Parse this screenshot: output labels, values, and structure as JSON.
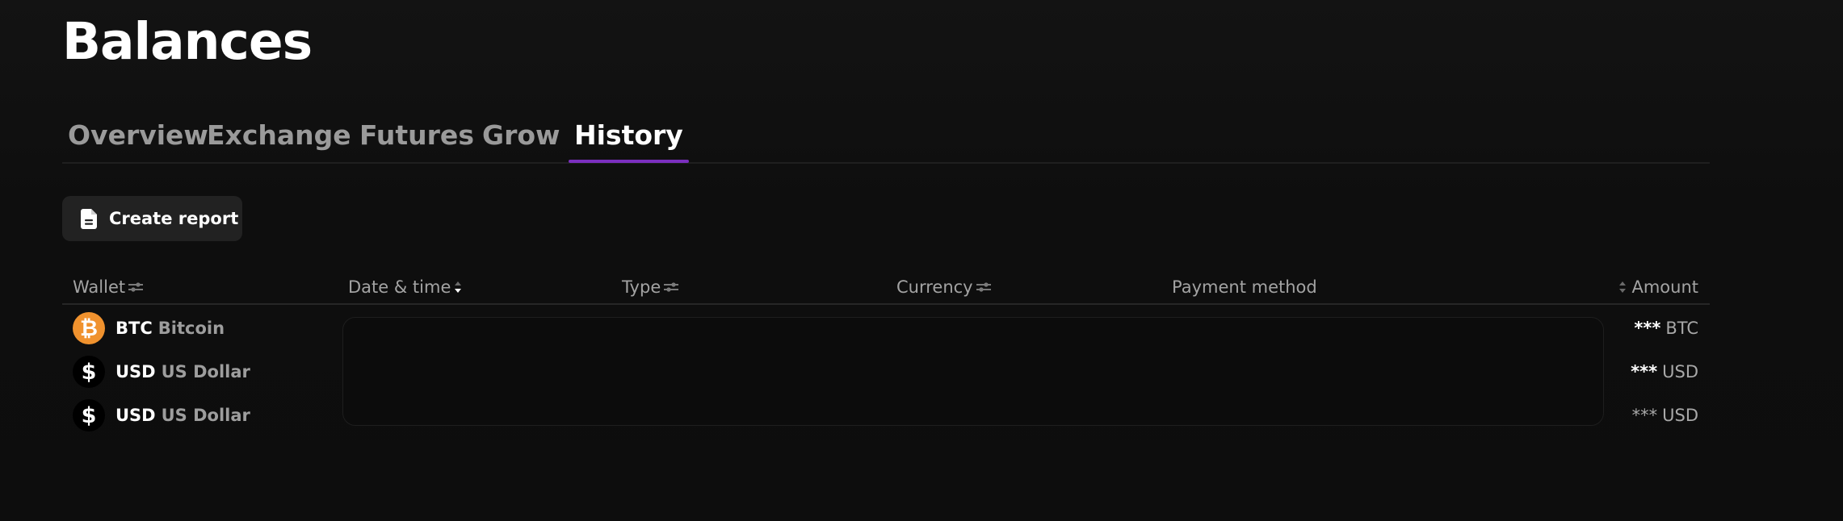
{
  "page": {
    "title": "Balances"
  },
  "tabs": [
    {
      "label": "Overview",
      "active": false
    },
    {
      "label": "Exchange",
      "active": false
    },
    {
      "label": "Futures",
      "active": false
    },
    {
      "label": "Grow",
      "active": false
    },
    {
      "label": "History",
      "active": true
    }
  ],
  "toolbar": {
    "create_report_label": "Create report",
    "create_report_icon": "document-icon"
  },
  "table": {
    "columns": {
      "wallet": "Wallet",
      "date_time": "Date & time",
      "type": "Type",
      "currency": "Currency",
      "payment_method": "Payment method",
      "amount": "Amount"
    },
    "rows": [
      {
        "code": "BTC",
        "name": "Bitcoin",
        "icon": "bitcoin-icon",
        "icon_glyph": "₿",
        "amount_mask": "***",
        "amount_unit": "BTC"
      },
      {
        "code": "USD",
        "name": "US Dollar",
        "icon": "dollar-icon",
        "icon_glyph": "$",
        "amount_mask": "***",
        "amount_unit": "USD"
      },
      {
        "code": "USD",
        "name": "US Dollar",
        "icon": "dollar-icon",
        "icon_glyph": "$",
        "amount_mask": "***",
        "amount_unit": "USD"
      }
    ]
  },
  "colors": {
    "background": "#0e0e0e",
    "accent": "#7b2fbf",
    "btc": "#f0922e",
    "button": "#222222",
    "muted_text": "#9a9a9a"
  }
}
